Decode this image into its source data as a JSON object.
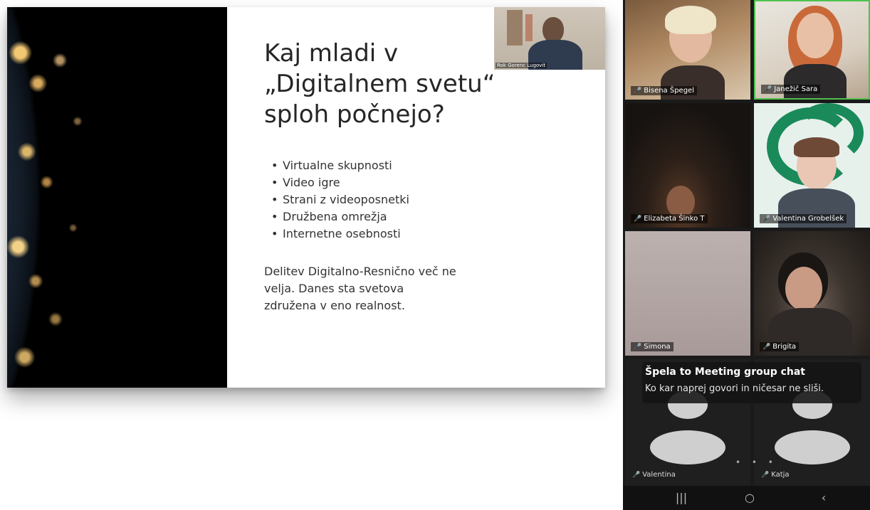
{
  "slide": {
    "title": "Kaj mladi v „Digitalnem svetu“ sploh počnejo?",
    "bullets": [
      "Virtualne skupnosti",
      "Video igre",
      "Strani z videoposnetki",
      "Družbena omrežja",
      "Internetne osebnosti"
    ],
    "note": "Delitev Digitalno-Resnično več ne velja. Danes sta svetova združena v eno realnost."
  },
  "presenter_pip": {
    "name": "Rok Gorenc Lugovit"
  },
  "participants": [
    {
      "name": "Bisena Špegel"
    },
    {
      "name": "Janežič Sara"
    },
    {
      "name": "Elizabeta Šinko T"
    },
    {
      "name": "Valentina Grobelšek"
    },
    {
      "name": "Simona"
    },
    {
      "name": "Brigita"
    },
    {
      "name": "Valentina"
    },
    {
      "name": "Katja"
    }
  ],
  "chat": {
    "title": "Špela to Meeting group chat",
    "message": "Ko kar naprej govori in ničesar ne sliši."
  },
  "pager": "• • •",
  "navbar": {
    "recent": "|||",
    "home": "○",
    "back": "‹"
  },
  "colors": {
    "active_speaker_border": "#4ec24e",
    "muted_mic": "#e33333",
    "logo_green": "#1a8a5a"
  }
}
